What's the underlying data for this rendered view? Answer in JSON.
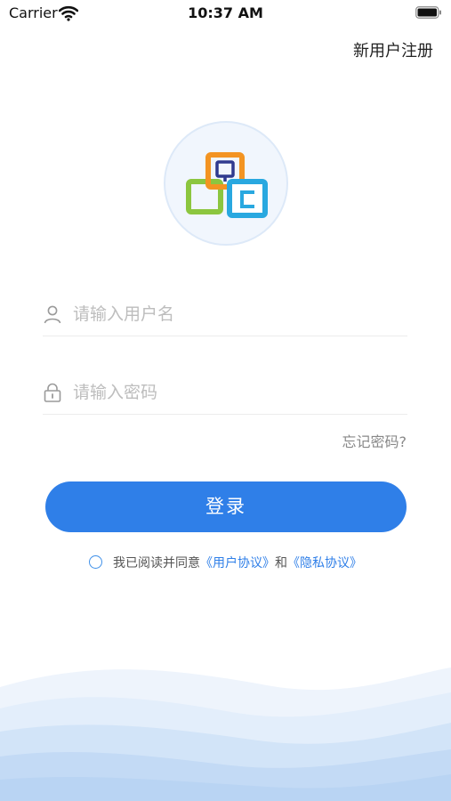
{
  "status_bar": {
    "carrier": "Carrier",
    "time": "10:37 AM",
    "icons": [
      "wifi-icon",
      "battery-icon"
    ]
  },
  "header": {
    "register_link": "新用户注册"
  },
  "logo": {
    "name": "app-logo",
    "colors": {
      "green": "#8cc63f",
      "orange": "#f39422",
      "blue": "#29a8e0",
      "navy": "#2f3a8f"
    }
  },
  "form": {
    "username": {
      "placeholder": "请输入用户名",
      "value": "",
      "icon": "user-icon"
    },
    "password": {
      "placeholder": "请输入密码",
      "value": "",
      "icon": "lock-icon"
    },
    "forgot_link": "忘记密码?",
    "login_button": "登录"
  },
  "agreement": {
    "checked": false,
    "prefix": "我已阅读并同意",
    "user_agreement": "《用户协议》",
    "conjunction": "和",
    "privacy_policy": "《隐私协议》"
  },
  "colors": {
    "accent": "#2f7fe8",
    "placeholder": "#bdbdbd",
    "wave_light": "#e3eefb",
    "wave_dark": "#b9d4f3"
  }
}
